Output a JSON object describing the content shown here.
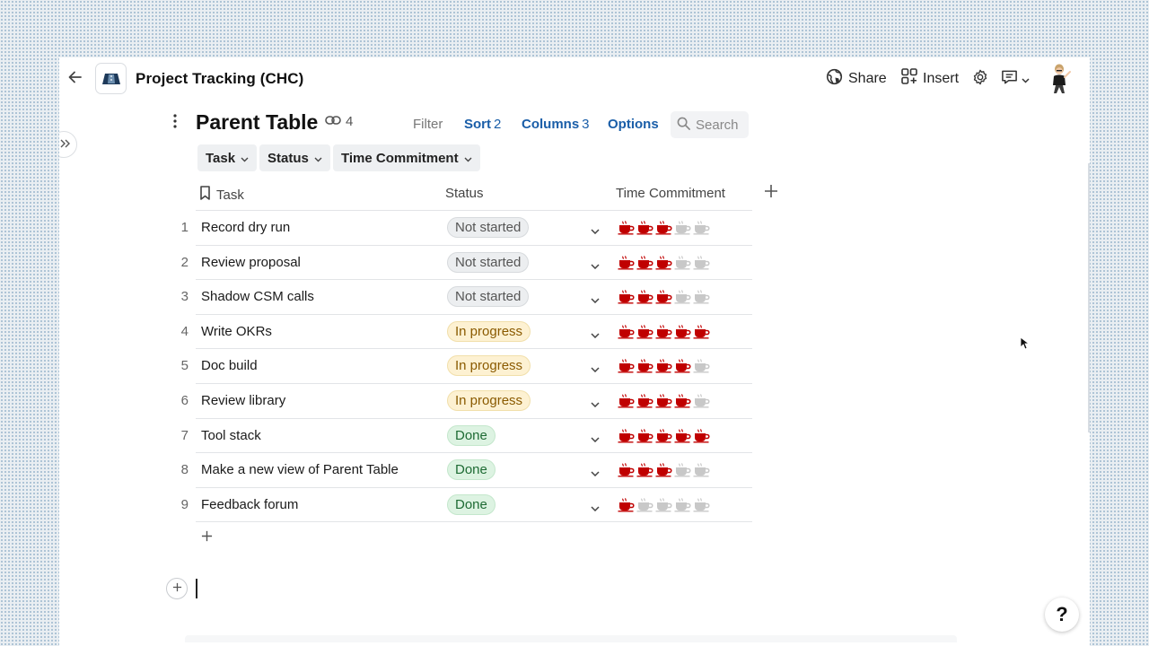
{
  "header": {
    "title": "Project Tracking (CHC)",
    "share_label": "Share",
    "insert_label": "Insert"
  },
  "table": {
    "title": "Parent Table",
    "link_count": "4",
    "toolbar": {
      "filter": "Filter",
      "sort": "Sort",
      "sort_count": "2",
      "columns": "Columns",
      "columns_count": "3",
      "options": "Options",
      "search_placeholder": "Search"
    },
    "group_chips": [
      "Task",
      "Status",
      "Time Commitment"
    ],
    "columns": [
      "Task",
      "Status",
      "Time Commitment"
    ],
    "rows": [
      {
        "num": "1",
        "task": "Record dry run",
        "status": "Not started",
        "cups": 3
      },
      {
        "num": "2",
        "task": "Review proposal",
        "status": "Not started",
        "cups": 3
      },
      {
        "num": "3",
        "task": "Shadow CSM calls",
        "status": "Not started",
        "cups": 3
      },
      {
        "num": "4",
        "task": "Write OKRs",
        "status": "In progress",
        "cups": 5
      },
      {
        "num": "5",
        "task": "Doc build",
        "status": "In progress",
        "cups": 4
      },
      {
        "num": "6",
        "task": "Review library",
        "status": "In progress",
        "cups": 4
      },
      {
        "num": "7",
        "task": "Tool stack",
        "status": "Done",
        "cups": 5
      },
      {
        "num": "8",
        "task": "Make a new view of Parent Table",
        "status": "Done",
        "cups": 3
      },
      {
        "num": "9",
        "task": "Feedback forum",
        "status": "Done",
        "cups": 1
      }
    ],
    "rating_max": 5
  },
  "help_label": "?",
  "colors": {
    "cup_filled": "#c00000",
    "cup_empty": "#c8c8c8",
    "link_blue": "#1a5ea8"
  }
}
